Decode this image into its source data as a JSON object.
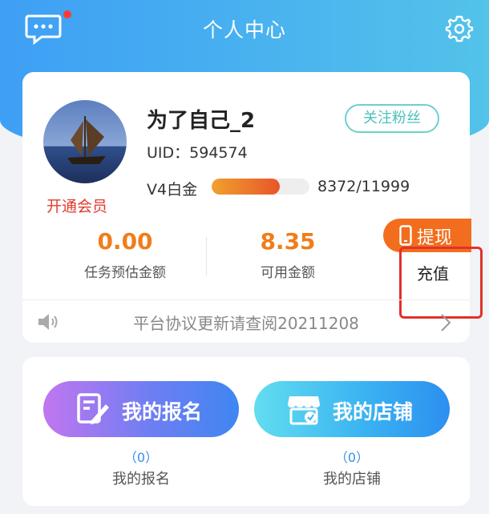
{
  "header": {
    "title": "个人中心",
    "colors": {
      "gradient_start": "#3e9ff5",
      "gradient_end": "#52c3ea"
    },
    "icons": {
      "left": "chat-bubble-icon",
      "right": "gear-icon"
    },
    "has_unread_dot": true
  },
  "profile": {
    "username": "为了自己_2",
    "uid_label": "UID：",
    "uid_value": "594574",
    "follow_button": "关注粉丝",
    "vip_link": "开通会员",
    "level_label": "V4白金",
    "level_value": "8372/11999",
    "level_progress": 0.698
  },
  "stats": [
    {
      "value": "0.00",
      "label": "任务预估金额"
    },
    {
      "value": "8.35",
      "label": "可用金额"
    }
  ],
  "actions": {
    "withdraw": "提现",
    "recharge": "充值"
  },
  "notice": {
    "text": "平台协议更新请查阅20211208",
    "icon": "speaker-icon"
  },
  "shortcuts": [
    {
      "button": "我的报名",
      "count": "（0）",
      "caption": "我的报名",
      "icon": "edit-form-icon"
    },
    {
      "button": "我的店铺",
      "count": "（0）",
      "caption": "我的店铺",
      "icon": "store-icon"
    }
  ],
  "colors": {
    "accent_orange": "#f07d1a",
    "vip_red": "#e23a2c",
    "highlight_red": "#e0322a"
  }
}
